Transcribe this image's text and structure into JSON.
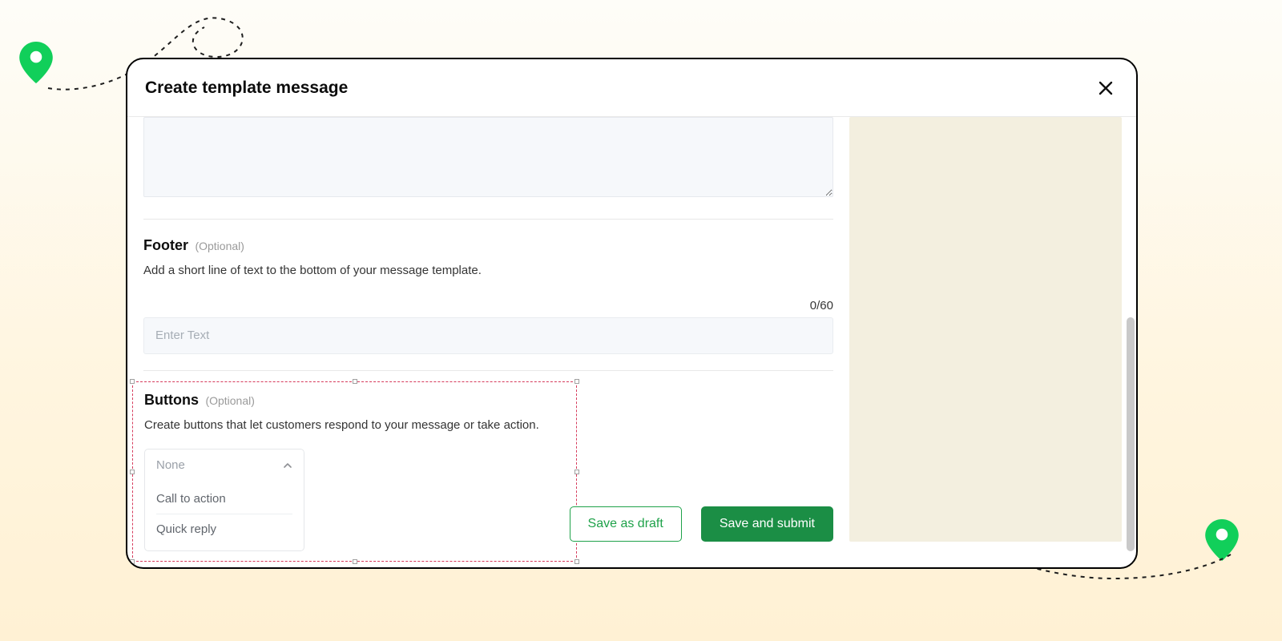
{
  "colors": {
    "accent": "#1b8e45",
    "pin": "#11cf5a"
  },
  "modal": {
    "title": "Create template message",
    "close_label": "Close"
  },
  "footer": {
    "title": "Footer",
    "optional": "(Optional)",
    "desc": "Add a short line of text to the bottom of your message template.",
    "count": "0/60",
    "placeholder": "Enter Text"
  },
  "buttons_section": {
    "title": "Buttons",
    "optional": "(Optional)",
    "desc": "Create buttons that let customers respond to your message or take action.",
    "dropdown": {
      "selected": "None",
      "options": [
        "Call to action",
        "Quick reply"
      ]
    }
  },
  "actions": {
    "draft": "Save as draft",
    "submit": "Save and submit"
  }
}
